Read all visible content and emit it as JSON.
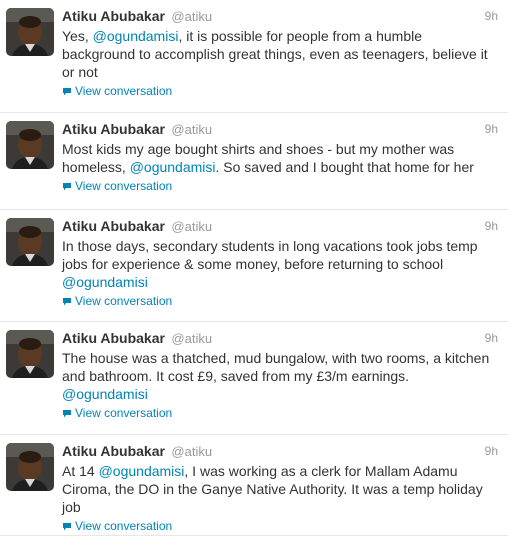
{
  "colors": {
    "link": "#0084b4",
    "meta": "#999999",
    "text": "#333333",
    "divider": "#e8e8e8"
  },
  "icons": {
    "avatar": "profile-photo",
    "conversation": "speech-bubble-icon"
  },
  "tweets": [
    {
      "name": "Atiku Abubakar",
      "handle": "@atiku",
      "time": "9h",
      "lines": [
        [
          "Yes, ",
          "@ogundamisi",
          ", it is possible for people from a humble"
        ],
        [
          "background to accomplish great things, even as teenagers, believe it"
        ],
        [
          "or not"
        ]
      ],
      "conversation": "View conversation"
    },
    {
      "name": "Atiku Abubakar",
      "handle": "@atiku",
      "time": "9h",
      "lines": [
        [
          "Most kids my age bought shirts and shoes - but my mother was"
        ],
        [
          "homeless, ",
          "@ogundamisi",
          ". So saved and I bought that home for her"
        ]
      ],
      "conversation": "View conversation"
    },
    {
      "name": "Atiku Abubakar",
      "handle": "@atiku",
      "time": "9h",
      "lines": [
        [
          "In those days, secondary students in long vacations took jobs temp"
        ],
        [
          "jobs for experience & some money, before returning to school"
        ],
        [
          "",
          "@ogundamisi"
        ]
      ],
      "conversation": "View conversation"
    },
    {
      "name": "Atiku Abubakar",
      "handle": "@atiku",
      "time": "9h",
      "lines": [
        [
          "The house was a thatched, mud bungalow, with two rooms, a kitchen"
        ],
        [
          "and bathroom. It cost £9, saved from my £3/m earnings."
        ],
        [
          "",
          "@ogundamisi"
        ]
      ],
      "conversation": "View conversation"
    },
    {
      "name": "Atiku Abubakar",
      "handle": "@atiku",
      "time": "9h",
      "lines": [
        [
          "At 14 ",
          "@ogundamisi",
          ", I was working as a clerk for Mallam Adamu"
        ],
        [
          "Ciroma, the DO in the Ganye Native Authority. It was a temp holiday"
        ],
        [
          "job"
        ]
      ],
      "conversation": "View conversation"
    }
  ]
}
